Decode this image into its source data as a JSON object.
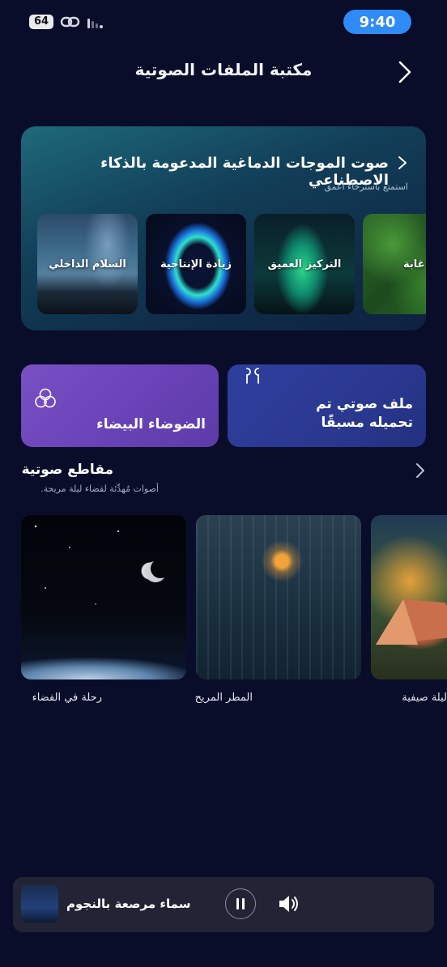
{
  "status_bar": {
    "battery": "64",
    "time": "9:40"
  },
  "header": {
    "title": "مكتبة الملفات الصوتية"
  },
  "ai_section": {
    "title": "صوت الموجات الدماغية المدعومة بالذكاء الاصطناعي",
    "subtitle": "استمتع باسترخاء أعمق",
    "tiles": [
      {
        "label": "السلام الداخلي"
      },
      {
        "label": "زيادة الإنتاجية"
      },
      {
        "label": "التركيز العميق"
      },
      {
        "label": "غابة"
      }
    ]
  },
  "quick_tiles": {
    "white_noise": "الضوضاء البيضاء",
    "preloaded_line1": "ملف صوتي تم",
    "preloaded_line2": "تحميله مسبقًا"
  },
  "clips_section": {
    "title": "مقاطع صوتية",
    "subtitle": "أصوات مُهدِّئة لقضاء ليلة مريحة.",
    "items": [
      {
        "label": "رحلة في الفضاء"
      },
      {
        "label": "المطر المريح"
      },
      {
        "label": "ليلة صيفية"
      }
    ]
  },
  "player": {
    "title": "سماء مرصعة بالنجوم",
    "state": "playing"
  },
  "icons": {
    "back": "chevron-right-icon",
    "section_more": "chevron-right-icon",
    "pause": "pause-icon",
    "volume": "speaker-icon"
  }
}
